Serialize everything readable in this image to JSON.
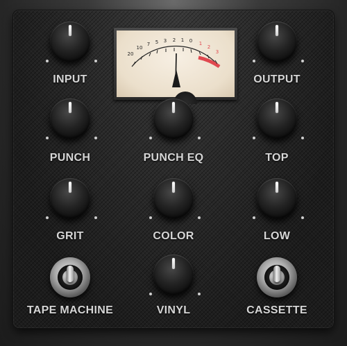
{
  "plugin": {
    "labels": {
      "input": "INPUT",
      "output": "OUTPUT",
      "punch": "PUNCH",
      "punch_eq": "PUNCH EQ",
      "top": "TOP",
      "grit": "GRIT",
      "color": "COLOR",
      "low": "LOW",
      "tape_machine": "TAPE MACHINE",
      "vinyl": "VINYL",
      "cassette": "CASSETTE"
    },
    "vu_meter": {
      "scale_labels": [
        "20",
        "10",
        "7",
        "5",
        "3",
        "2",
        "1",
        "0",
        "1",
        "2",
        "3"
      ],
      "needle_value": "0",
      "colors": {
        "face": "#efe6d6",
        "scale": "#222222",
        "red_zone": "#e0484f",
        "needle": "#111111"
      }
    },
    "knob_indicator_color": "#ffffff",
    "label_color": "#d6d6d6"
  }
}
